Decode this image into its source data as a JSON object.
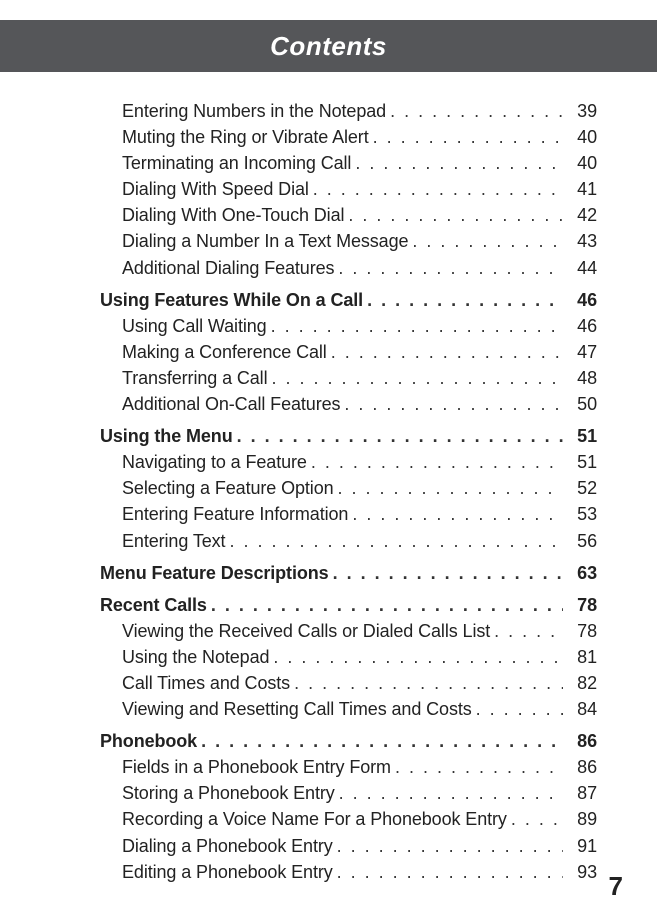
{
  "header": {
    "title": "Contents"
  },
  "toc": [
    {
      "type": "sub",
      "label": "Entering Numbers in the Notepad",
      "page": "39"
    },
    {
      "type": "sub",
      "label": "Muting the Ring or Vibrate Alert",
      "page": "40"
    },
    {
      "type": "sub",
      "label": "Terminating an Incoming Call",
      "page": "40"
    },
    {
      "type": "sub",
      "label": "Dialing With Speed Dial",
      "page": "41"
    },
    {
      "type": "sub",
      "label": "Dialing With One-Touch Dial",
      "page": "42"
    },
    {
      "type": "sub",
      "label": "Dialing a Number In a Text Message",
      "page": "43"
    },
    {
      "type": "sub",
      "label": "Additional Dialing Features",
      "page": "44"
    },
    {
      "type": "section",
      "label": "Using Features While On a Call",
      "page": "46"
    },
    {
      "type": "sub",
      "label": "Using Call Waiting",
      "page": "46"
    },
    {
      "type": "sub",
      "label": "Making a Conference Call",
      "page": "47"
    },
    {
      "type": "sub",
      "label": "Transferring a Call",
      "page": "48"
    },
    {
      "type": "sub",
      "label": "Additional On-Call Features",
      "page": "50"
    },
    {
      "type": "section",
      "label": "Using the Menu",
      "page": "51"
    },
    {
      "type": "sub",
      "label": "Navigating to a Feature",
      "page": "51"
    },
    {
      "type": "sub",
      "label": "Selecting a Feature Option",
      "page": "52"
    },
    {
      "type": "sub",
      "label": "Entering Feature Information",
      "page": "53"
    },
    {
      "type": "sub",
      "label": "Entering Text",
      "page": "56"
    },
    {
      "type": "section",
      "label": "Menu Feature Descriptions",
      "page": "63"
    },
    {
      "type": "section",
      "label": "Recent Calls",
      "page": "78"
    },
    {
      "type": "sub",
      "label": "Viewing the Received Calls or Dialed Calls List",
      "page": "78"
    },
    {
      "type": "sub",
      "label": "Using the Notepad",
      "page": "81"
    },
    {
      "type": "sub",
      "label": "Call Times and Costs",
      "page": "82"
    },
    {
      "type": "sub",
      "label": "Viewing and Resetting Call Times and Costs",
      "page": "84"
    },
    {
      "type": "section",
      "label": "Phonebook",
      "page": "86"
    },
    {
      "type": "sub",
      "label": "Fields in a Phonebook Entry Form",
      "page": "86"
    },
    {
      "type": "sub",
      "label": "Storing a Phonebook Entry",
      "page": "87"
    },
    {
      "type": "sub",
      "label": "Recording a Voice Name For a Phonebook Entry",
      "page": "89"
    },
    {
      "type": "sub",
      "label": "Dialing a Phonebook Entry",
      "page": "91"
    },
    {
      "type": "sub",
      "label": "Editing a Phonebook Entry",
      "page": "93"
    }
  ],
  "page_number": "7"
}
